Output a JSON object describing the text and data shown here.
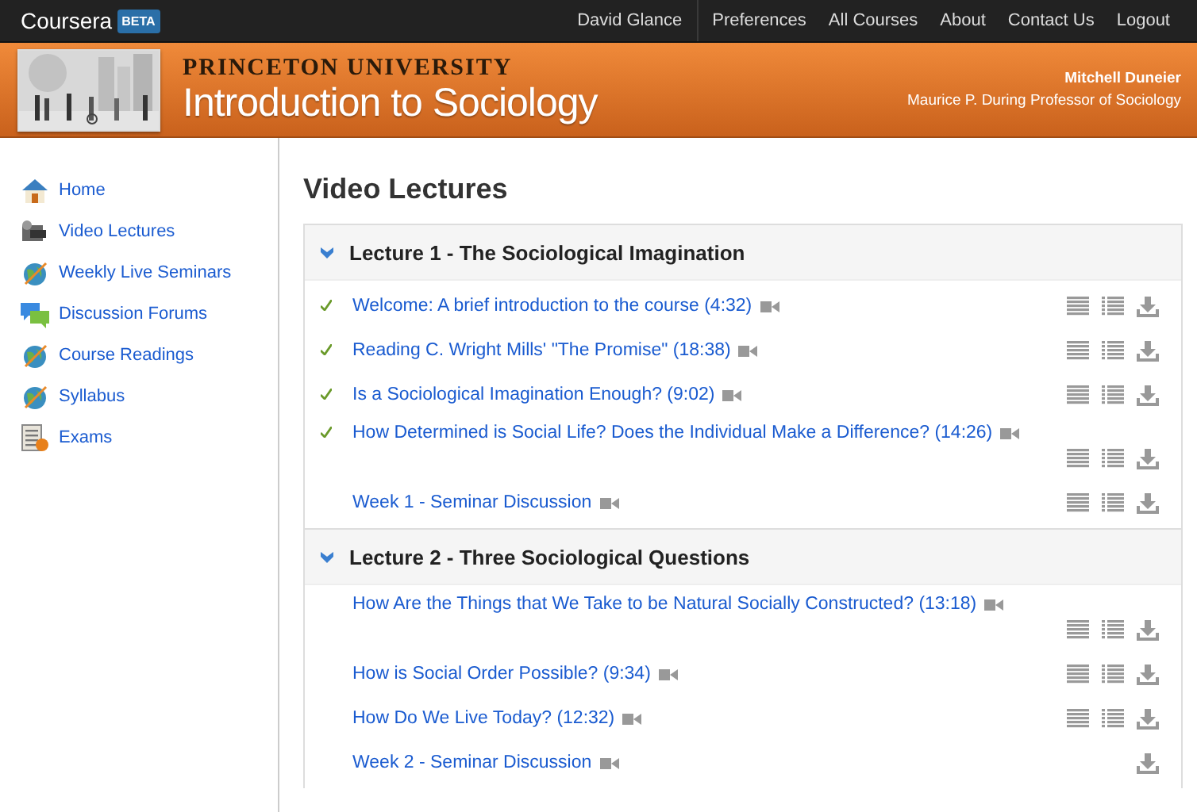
{
  "topbar": {
    "logo": "Coursera",
    "badge": "BETA",
    "links": [
      "David Glance",
      "Preferences",
      "All Courses",
      "About",
      "Contact Us",
      "Logout"
    ]
  },
  "banner": {
    "university": "PRINCETON UNIVERSITY",
    "course": "Introduction to Sociology",
    "instructor": "Mitchell Duneier",
    "instructor_title": "Maurice P. During Professor of Sociology"
  },
  "sidebar": {
    "items": [
      {
        "label": "Home",
        "kind": "home"
      },
      {
        "label": "Video Lectures",
        "kind": "video"
      },
      {
        "label": "Weekly Live Seminars",
        "kind": "globe"
      },
      {
        "label": "Discussion Forums",
        "kind": "chat"
      },
      {
        "label": "Course Readings",
        "kind": "globe"
      },
      {
        "label": "Syllabus",
        "kind": "globe"
      },
      {
        "label": "Exams",
        "kind": "exam"
      }
    ]
  },
  "main": {
    "title": "Video Lectures",
    "sections": [
      {
        "title": "Lecture 1 - The Sociological Imagination",
        "expanded": true,
        "items": [
          {
            "title": "Welcome: A brief introduction to the course (4:32)",
            "watched": true,
            "slides": true,
            "subtitles": true,
            "download": true
          },
          {
            "title": "Reading C. Wright Mills' \"The Promise\" (18:38)",
            "watched": true,
            "slides": true,
            "subtitles": true,
            "download": true
          },
          {
            "title": "Is a Sociological Imagination Enough? (9:02)",
            "watched": true,
            "slides": true,
            "subtitles": true,
            "download": true
          },
          {
            "title": "How Determined is Social Life? Does the Individual Make a Difference? (14:26)",
            "watched": true,
            "slides": true,
            "subtitles": true,
            "download": true
          },
          {
            "title": "Week 1 - Seminar Discussion",
            "watched": false,
            "slides": true,
            "subtitles": true,
            "download": true
          }
        ]
      },
      {
        "title": "Lecture 2 - Three Sociological Questions",
        "expanded": true,
        "items": [
          {
            "title": "How Are the Things that We Take to be Natural Socially Constructed? (13:18)",
            "watched": false,
            "slides": true,
            "subtitles": true,
            "download": true
          },
          {
            "title": "How is Social Order Possible? (9:34)",
            "watched": false,
            "slides": true,
            "subtitles": true,
            "download": true
          },
          {
            "title": "How Do We Live Today? (12:32)",
            "watched": false,
            "slides": true,
            "subtitles": true,
            "download": true
          },
          {
            "title": "Week 2 - Seminar Discussion",
            "watched": false,
            "slides": false,
            "subtitles": false,
            "download": true
          }
        ]
      }
    ]
  }
}
